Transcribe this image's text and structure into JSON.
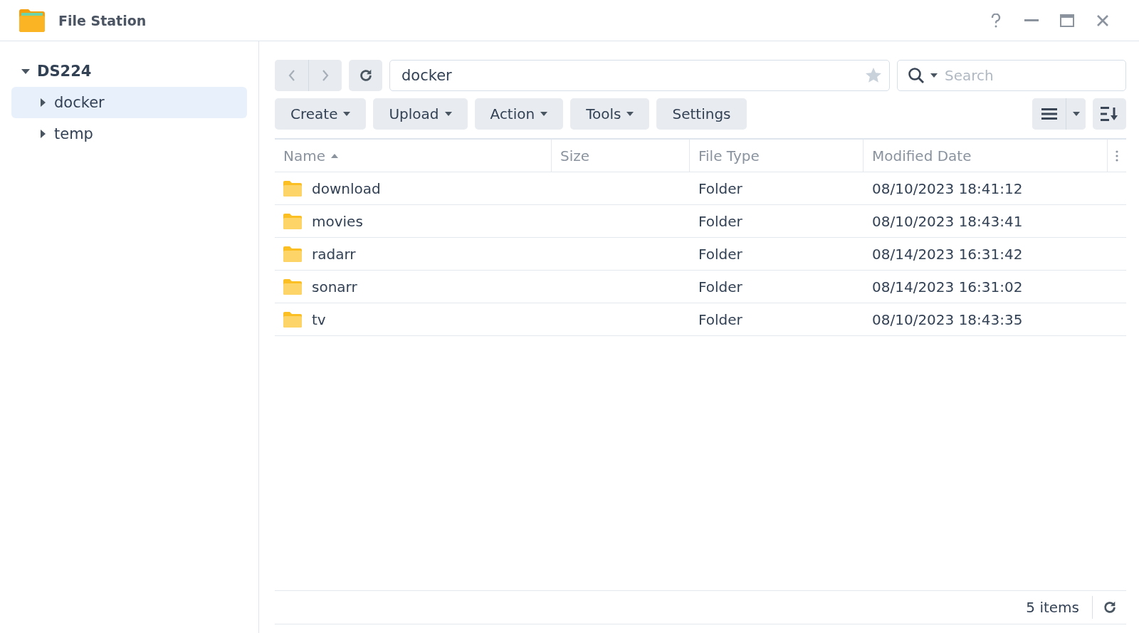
{
  "window": {
    "title": "File Station"
  },
  "sidebar": {
    "tree": [
      {
        "label": "DS224",
        "expanded": true,
        "selected": false,
        "children": [
          {
            "label": "docker",
            "expanded": false,
            "selected": true
          },
          {
            "label": "temp",
            "expanded": false,
            "selected": false
          }
        ]
      }
    ]
  },
  "path_field": {
    "value": "docker"
  },
  "search": {
    "placeholder": "Search"
  },
  "toolbar": [
    {
      "label": "Create",
      "has_menu": true
    },
    {
      "label": "Upload",
      "has_menu": true
    },
    {
      "label": "Action",
      "has_menu": true
    },
    {
      "label": "Tools",
      "has_menu": true
    },
    {
      "label": "Settings",
      "has_menu": false
    }
  ],
  "table": {
    "columns": [
      {
        "label": "Name",
        "sorted": true
      },
      {
        "label": "Size",
        "sorted": false
      },
      {
        "label": "File Type",
        "sorted": false
      },
      {
        "label": "Modified Date",
        "sorted": false
      }
    ],
    "rows": [
      {
        "name": "download",
        "type": "Folder",
        "modified": "08/10/2023 18:41:12"
      },
      {
        "name": "movies",
        "type": "Folder",
        "modified": "08/10/2023 18:43:41"
      },
      {
        "name": "radarr",
        "type": "Folder",
        "modified": "08/14/2023 16:31:42"
      },
      {
        "name": "sonarr",
        "type": "Folder",
        "modified": "08/14/2023 16:31:02"
      },
      {
        "name": "tv",
        "type": "Folder",
        "modified": "08/10/2023 18:43:35"
      }
    ]
  },
  "status_bar": {
    "count": "5 items"
  }
}
